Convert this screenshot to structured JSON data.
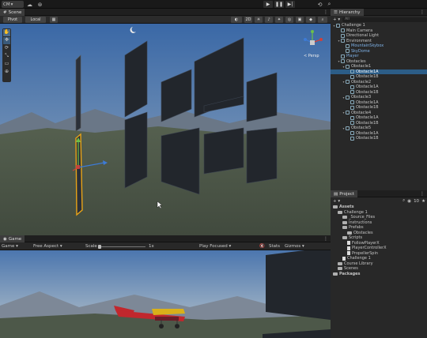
{
  "toolbar": {
    "account_label": "CM",
    "play_icon": "play-icon",
    "pause_icon": "pause-icon",
    "step_icon": "step-icon"
  },
  "scene": {
    "tab_label": "Scene",
    "pivot_label": "Pivot",
    "local_label": "Local",
    "persp_label": "< Persp"
  },
  "game": {
    "tab_label": "Game",
    "display_label": "Game",
    "aspect_label": "Free Aspect",
    "scale_label": "Scale",
    "scale_value": "1x",
    "play_focused_label": "Play Focused",
    "stats_label": "Stats",
    "gizmos_label": "Gizmos"
  },
  "hierarchy": {
    "tab_label": "Hierarchy",
    "search_placeholder": "All",
    "items": [
      {
        "label": "Challenge 1",
        "depth": 0,
        "expanded": true
      },
      {
        "label": "Main Camera",
        "depth": 1
      },
      {
        "label": "Directional Light",
        "depth": 1
      },
      {
        "label": "Environment",
        "depth": 1,
        "expanded": true
      },
      {
        "label": "MountainSkybox",
        "depth": 2,
        "color": "blue"
      },
      {
        "label": "SkyDome",
        "depth": 2,
        "color": "blue"
      },
      {
        "label": "Player",
        "depth": 1,
        "color": "blue"
      },
      {
        "label": "Obstacles",
        "depth": 1,
        "expanded": true
      },
      {
        "label": "Obstacle1",
        "depth": 2,
        "expanded": true
      },
      {
        "label": "Obstacle1A",
        "depth": 3,
        "selected": true
      },
      {
        "label": "Obstacle1B",
        "depth": 3
      },
      {
        "label": "Obstacle2",
        "depth": 2,
        "expanded": true
      },
      {
        "label": "Obstacle1A",
        "depth": 3
      },
      {
        "label": "Obstacle1B",
        "depth": 3
      },
      {
        "label": "Obstacle3",
        "depth": 2,
        "expanded": true
      },
      {
        "label": "Obstacle1A",
        "depth": 3
      },
      {
        "label": "Obstacle1B",
        "depth": 3
      },
      {
        "label": "Obstacle4",
        "depth": 2,
        "expanded": true
      },
      {
        "label": "Obstacle1A",
        "depth": 3
      },
      {
        "label": "Obstacle1B",
        "depth": 3
      },
      {
        "label": "Obstacle5",
        "depth": 2,
        "expanded": true
      },
      {
        "label": "Obstacle1A",
        "depth": 3
      },
      {
        "label": "Obstacle1B",
        "depth": 3
      }
    ]
  },
  "project": {
    "tab_label": "Project",
    "count": "10",
    "items": [
      {
        "label": "Assets",
        "depth": 0,
        "kind": "folder",
        "bold": true
      },
      {
        "label": "Challenge 1",
        "depth": 1,
        "kind": "folder"
      },
      {
        "label": "_Source_Files",
        "depth": 2,
        "kind": "folder"
      },
      {
        "label": "Instructions",
        "depth": 2,
        "kind": "folder"
      },
      {
        "label": "Prefabs",
        "depth": 2,
        "kind": "folder"
      },
      {
        "label": "Obstacles",
        "depth": 3,
        "kind": "folder"
      },
      {
        "label": "Scripts",
        "depth": 2,
        "kind": "folder"
      },
      {
        "label": "FollowPlayerX",
        "depth": 3,
        "kind": "file"
      },
      {
        "label": "PlayerControllerX",
        "depth": 3,
        "kind": "file"
      },
      {
        "label": "PropellerSpin",
        "depth": 3,
        "kind": "file"
      },
      {
        "label": "Challenge 1",
        "depth": 2,
        "kind": "file"
      },
      {
        "label": "Course Library",
        "depth": 1,
        "kind": "folder"
      },
      {
        "label": "Scenes",
        "depth": 1,
        "kind": "folder"
      },
      {
        "label": "Packages",
        "depth": 0,
        "kind": "folder",
        "bold": true
      }
    ]
  },
  "colors": {
    "sky_top": "#3d6aa8",
    "sky_horizon": "#8aa0b8",
    "ground": "#4f5a49",
    "selection": "#2c5d87",
    "obstacle": "#22262c",
    "select_outline": "#e8a317"
  }
}
